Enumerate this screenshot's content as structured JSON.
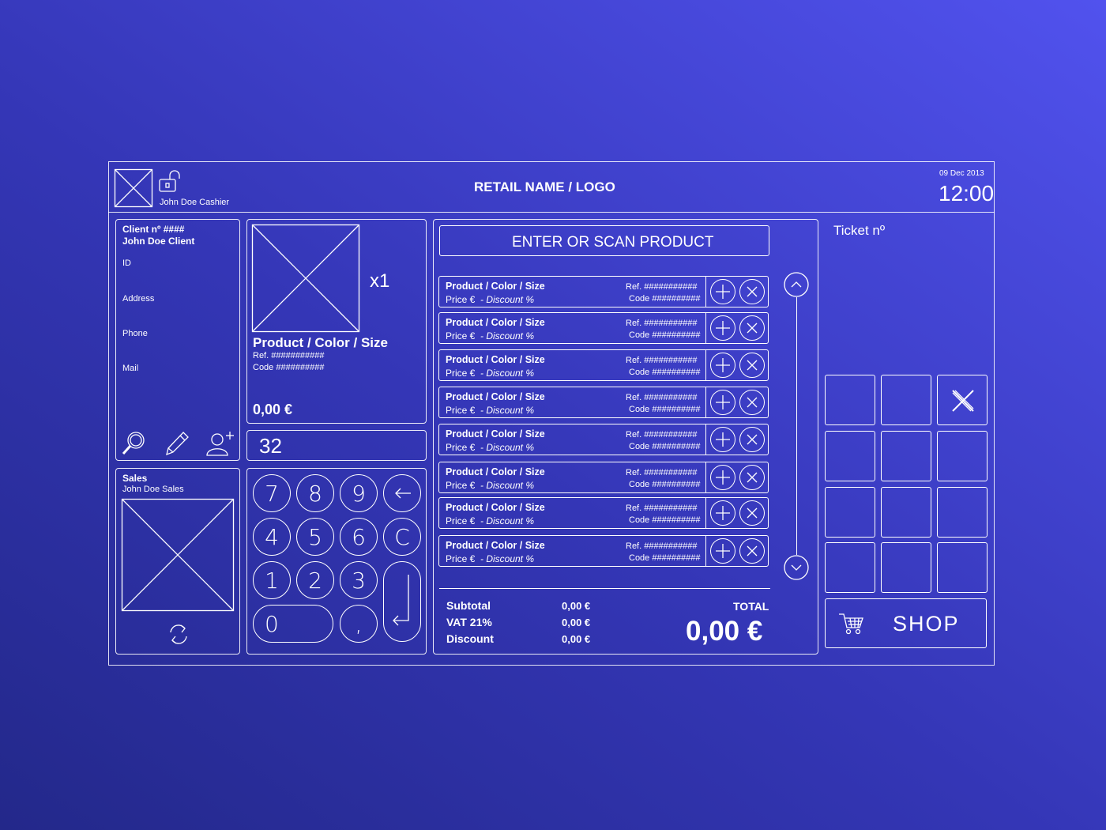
{
  "header": {
    "cashier": "John Doe Cashier",
    "retail": "RETAIL NAME / LOGO",
    "date": "09 Dec 2013",
    "time": "12:00"
  },
  "client": {
    "number": "Client nº ####",
    "name": "John Doe Client",
    "fields": [
      "ID",
      "Address",
      "Phone",
      "Mail"
    ]
  },
  "sales": {
    "title": "Sales",
    "name": "John Doe Sales"
  },
  "preview": {
    "qty": "x1",
    "name": "Product / Color / Size",
    "ref": "Ref. ###########",
    "code": "Code ##########",
    "price": "0,00 €"
  },
  "display": {
    "value": "32"
  },
  "keypad": [
    "7",
    "8",
    "9",
    "4",
    "5",
    "6",
    "1",
    "2",
    "3",
    "0",
    ",",
    "C"
  ],
  "scan": {
    "label": "ENTER OR SCAN PRODUCT"
  },
  "items": [
    {
      "name": "Product / Color / Size",
      "price": "Price €",
      "discount": "- Discount %",
      "ref": "Ref. ###########",
      "code": "Code ##########"
    },
    {
      "name": "Product / Color / Size",
      "price": "Price €",
      "discount": "- Discount %",
      "ref": "Ref. ###########",
      "code": "Code ##########"
    },
    {
      "name": "Product / Color / Size",
      "price": "Price €",
      "discount": "- Discount %",
      "ref": "Ref. ###########",
      "code": "Code ##########"
    },
    {
      "name": "Product / Color / Size",
      "price": "Price €",
      "discount": "- Discount %",
      "ref": "Ref. ###########",
      "code": "Code ##########"
    },
    {
      "name": "Product / Color / Size",
      "price": "Price €",
      "discount": "- Discount %",
      "ref": "Ref. ###########",
      "code": "Code ##########"
    },
    {
      "name": "Product / Color / Size",
      "price": "Price €",
      "discount": "- Discount %",
      "ref": "Ref. ###########",
      "code": "Code ##########"
    },
    {
      "name": "Product / Color / Size",
      "price": "Price €",
      "discount": "- Discount %",
      "ref": "Ref. ###########",
      "code": "Code ##########"
    },
    {
      "name": "Product / Color / Size",
      "price": "Price €",
      "discount": "- Discount %",
      "ref": "Ref. ###########",
      "code": "Code ##########"
    }
  ],
  "totals": {
    "subtotal_label": "Subtotal",
    "subtotal": "0,00 €",
    "vat_label": "VAT 21%",
    "vat": "0,00 €",
    "discount_label": "Discount",
    "discount": "0,00 €",
    "total_label": "TOTAL",
    "total": "0,00 €"
  },
  "ticket": {
    "label": "Ticket nº"
  },
  "shop": {
    "label": "SHOP"
  },
  "icons": [
    "logo-placeholder-icon",
    "unlock-icon",
    "search-icon",
    "edit-icon",
    "add-user-icon",
    "refresh-icon",
    "backspace-icon",
    "enter-icon",
    "plus-icon",
    "close-icon",
    "chevron-up-icon",
    "chevron-down-icon",
    "cart-icon"
  ]
}
